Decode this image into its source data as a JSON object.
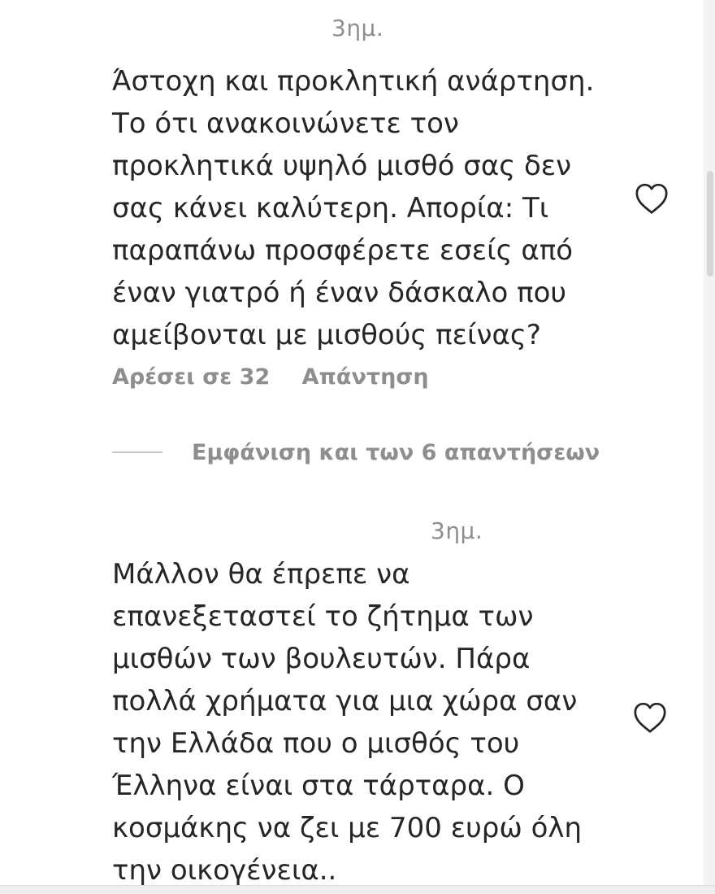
{
  "comments": [
    {
      "timestamp": "3ημ.",
      "text": "Άστοχη και προκλητική ανάρτηση.\nΤο ότι ανακοινώνετε τον\nπροκλητικά υψηλό μισθό σας δεν\nσας κάνει καλύτερη. Απορία: Τι\nπαραπάνω προσφέρετε εσείς από\nέναν γιατρό ή έναν δάσκαλο που\nαμείβονται με μισθούς πείνας?",
      "likes_label": "Αρέσει σε 32",
      "reply_label": "Απάντηση",
      "like_icon": "heart-outline-icon",
      "view_replies_label": "Εμφάνιση και των 6 απαντήσεων"
    },
    {
      "timestamp": "3ημ.",
      "text": "Μάλλον θα έπρεπε να\nεπανεξεταστεί το ζήτημα των\nμισθών των βουλευτών. Πάρα\nπολλά χρήματα για μια χώρα σαν\nτην Ελλάδα που ο μισθός του\nΈλληνα είναι στα τάρταρα. Ο\nκοσμάκης να ζει με 700 ευρώ όλη\nτην οικογένεια..",
      "like_icon": "heart-outline-icon"
    }
  ]
}
